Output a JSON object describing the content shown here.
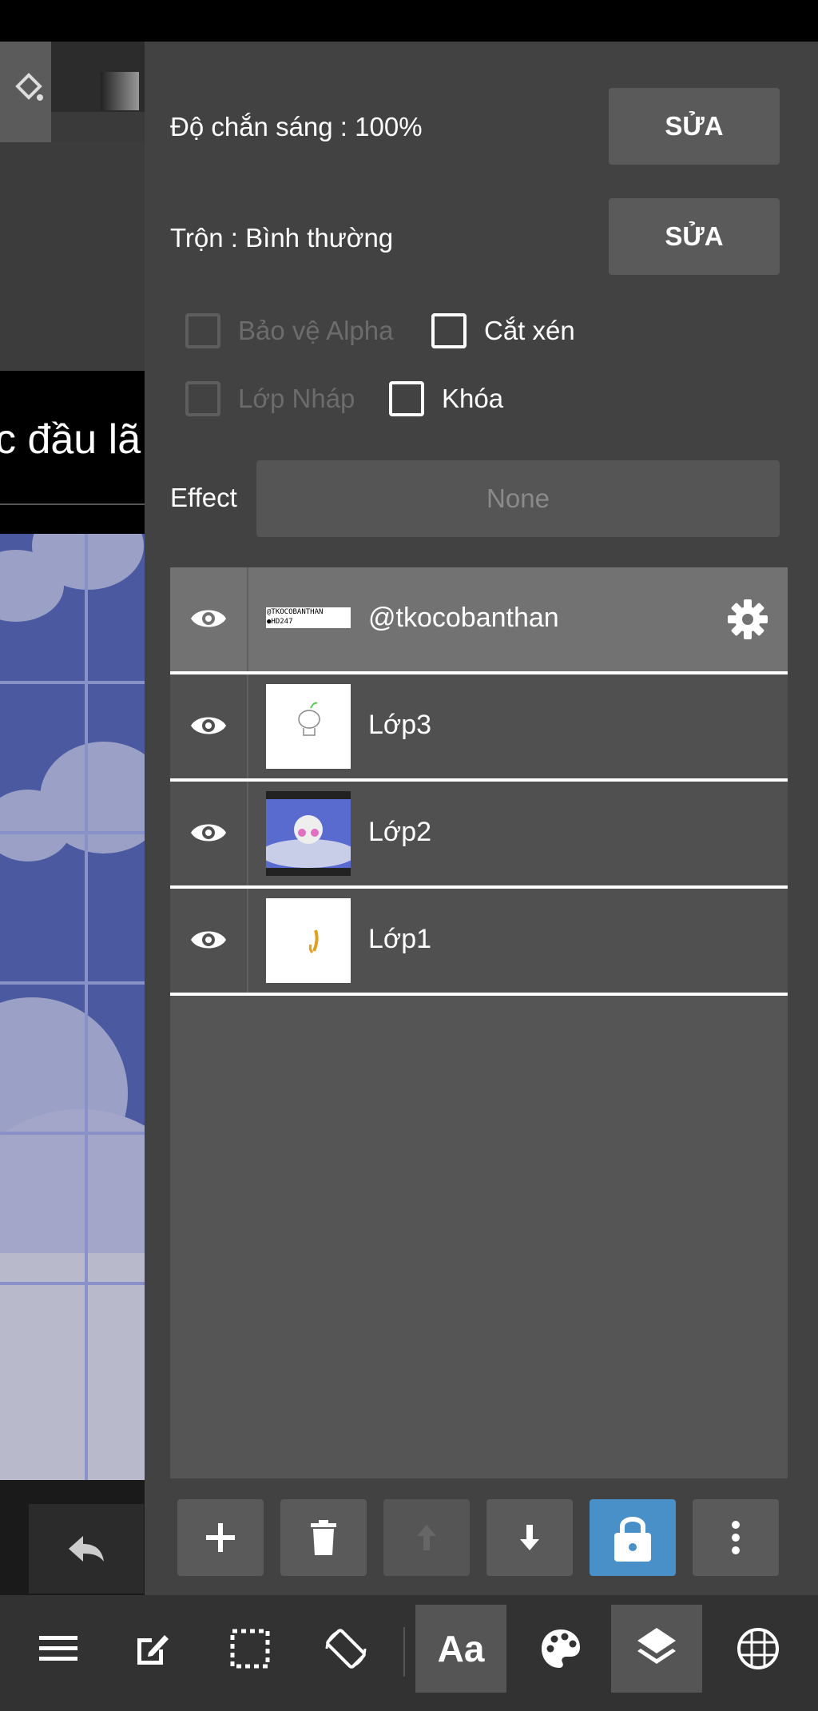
{
  "canvas": {
    "doc_text": "c đầu lã"
  },
  "panel": {
    "opacity_label": "Độ chắn sáng : 100%",
    "opacity_edit": "SỬA",
    "blend_label": "Trộn : Bình thường",
    "blend_edit": "SỬA",
    "checkboxes": {
      "alpha_protect": "Bảo vệ Alpha",
      "clipping": "Cắt xén",
      "draft_layer": "Lớp Nháp",
      "lock": "Khóa"
    },
    "effect_label": "Effect",
    "effect_value": "None"
  },
  "layers": [
    {
      "name": "@tkocobanthan",
      "thumb_text": "@TKOCOBANTHAN ●HD247",
      "selected": true
    },
    {
      "name": "Lớp3"
    },
    {
      "name": "Lớp2"
    },
    {
      "name": "Lớp1"
    }
  ],
  "toolbar": {
    "text_tool": "Aa"
  },
  "colors": {
    "panel_bg": "#424242",
    "selected_layer": "#727272",
    "active_lock": "#4a90c8",
    "canvas_blue": "#4b5aa0"
  }
}
